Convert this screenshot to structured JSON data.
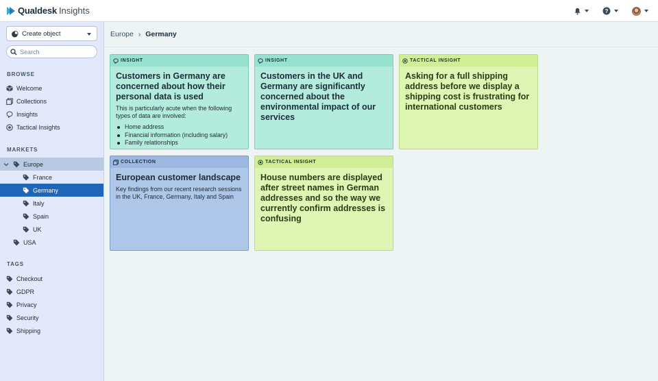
{
  "app": {
    "brand_name": "Qualdesk",
    "brand_sub": "Insights"
  },
  "topbar": {
    "icons": [
      "bell-icon",
      "help-icon",
      "avatar"
    ]
  },
  "sidebar": {
    "create_label": "Create object",
    "search_placeholder": "Search",
    "browse_heading": "BROWSE",
    "browse_items": [
      {
        "label": "Welcome",
        "icon": "cube-icon"
      },
      {
        "label": "Collections",
        "icon": "collection-icon"
      },
      {
        "label": "Insights",
        "icon": "insight-icon"
      },
      {
        "label": "Tactical Insights",
        "icon": "target-icon"
      }
    ],
    "markets_heading": "MARKETS",
    "markets": {
      "europe": "Europe",
      "france": "France",
      "germany": "Germany",
      "italy": "Italy",
      "spain": "Spain",
      "uk": "UK",
      "usa": "USA"
    },
    "tags_heading": "TAGS",
    "tags": [
      "Checkout",
      "GDPR",
      "Privacy",
      "Security",
      "Shipping"
    ]
  },
  "breadcrumb": {
    "parent": "Europe",
    "separator": "›",
    "current": "Germany"
  },
  "cards": [
    {
      "type": "INSIGHT",
      "title": "Customers in Germany are concerned about how their personal data is used",
      "body": "This is particularly acute when the following types of data are involved:",
      "list": [
        "Home address",
        "Financial information (including salary)",
        "Family relationships"
      ]
    },
    {
      "type": "INSIGHT",
      "title": "Customers in the UK and Germany are significantly concerned about the environmental impact of our services"
    },
    {
      "type": "TACTICAL INSIGHT",
      "title": "Asking for a full shipping address before we display a shipping cost is frustrating for international customers"
    },
    {
      "type": "COLLECTION",
      "title": "European customer landscape",
      "body": "Key findings from our recent research sessions in the UK, France, Germany, Italy and Spain"
    },
    {
      "type": "TACTICAL INSIGHT",
      "title": "House numbers are displayed after street names in German addresses and so the way we currently confirm addresses is confusing"
    }
  ],
  "colors": {
    "active_nav": "#1f65b8",
    "insight": "#b3ecdd",
    "tactical": "#def5b3",
    "collection": "#afc7e9"
  }
}
